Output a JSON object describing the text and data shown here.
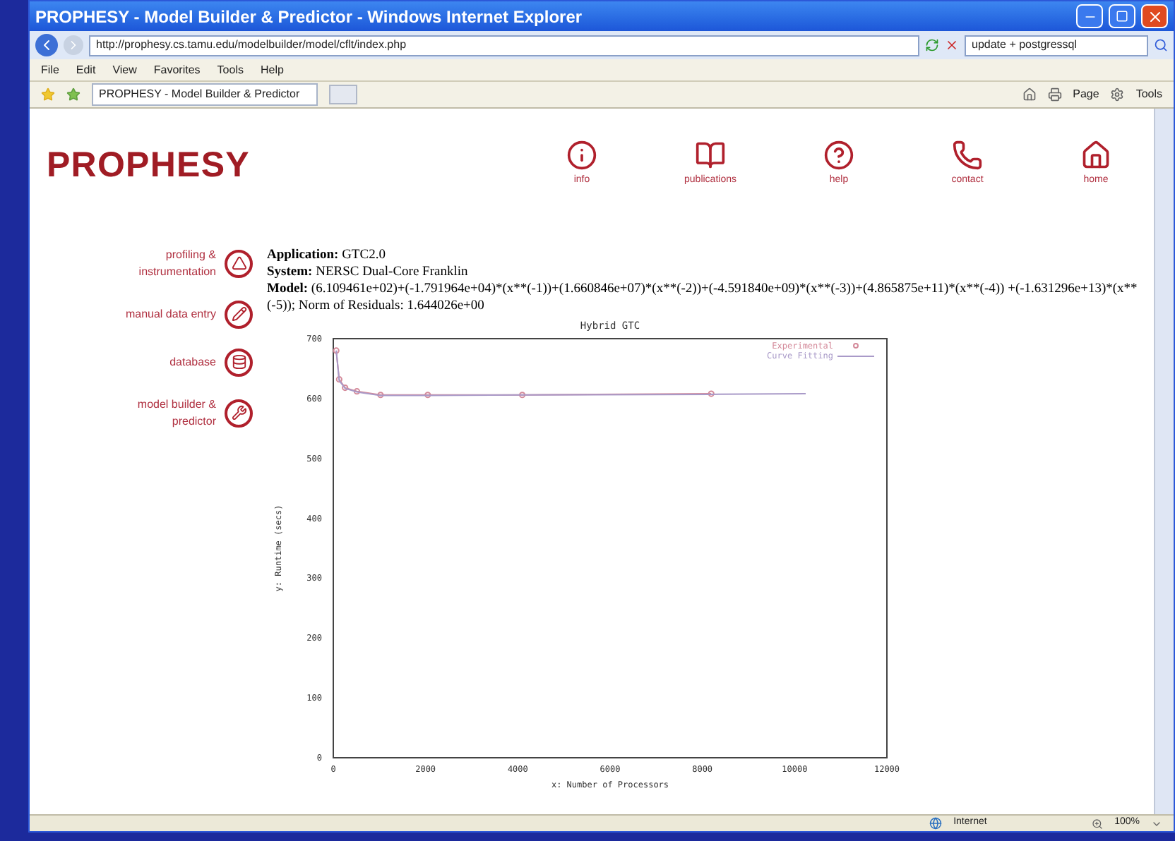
{
  "window": {
    "title": "PROPHESY - Model Builder & Predictor - Windows Internet Explorer"
  },
  "address_bar": {
    "url": "http://prophesy.cs.tamu.edu/modelbuilder/model/cflt/index.php",
    "search_value": "update + postgressql"
  },
  "menu": [
    "File",
    "Edit",
    "View",
    "Favorites",
    "Tools",
    "Help"
  ],
  "tab": {
    "title": "PROPHESY - Model Builder & Predictor"
  },
  "command_bar": [
    "Page",
    "Tools"
  ],
  "page": {
    "logo": "PROPHESY",
    "top_nav": [
      {
        "kind": "info",
        "label": "info"
      },
      {
        "kind": "publications",
        "label": "publications"
      },
      {
        "kind": "help",
        "label": "help"
      },
      {
        "kind": "contact",
        "label": "contact"
      },
      {
        "kind": "home",
        "label": "home"
      }
    ],
    "side_nav": [
      {
        "kind": "profiling",
        "label": "profiling & instrumentation"
      },
      {
        "kind": "entry",
        "label": "manual data entry"
      },
      {
        "kind": "database",
        "label": "database"
      },
      {
        "kind": "builder",
        "label": "model builder & predictor"
      }
    ],
    "info": [
      {
        "label": "Application:",
        "value": "GTC2.0"
      },
      {
        "label": "System:",
        "value": "NERSC Dual-Core Franklin"
      },
      {
        "label": "Model:",
        "value": "(6.109461e+02)+(-1.791964e+04)*(x**(-1))+(1.660846e+07)*(x**(-2))+(-4.591840e+09)*(x**(-3))+(4.865875e+11)*(x**(-4)) +(-1.631296e+13)*(x**(-5)); Norm of Residuals: 1.644026e+00"
      }
    ],
    "chart_data": {
      "type": "line",
      "title": "Hybrid GTC",
      "xlabel": "x: Number of Processors",
      "ylabel": "y: Runtime (secs)",
      "x": [
        64,
        128,
        256,
        512,
        1024,
        2048,
        4096,
        8192,
        10240
      ],
      "series": [
        {
          "name": "Experimental",
          "color": "#d48a9a",
          "marker": "circle",
          "values": [
            680,
            632,
            618,
            612,
            606,
            606,
            606,
            608,
            null
          ]
        },
        {
          "name": "Curve Fitting",
          "color": "#a99ac8",
          "values": [
            680,
            630,
            617,
            611,
            605,
            605,
            606,
            607,
            608
          ]
        }
      ],
      "xlim": [
        0,
        12000
      ],
      "ylim": [
        0,
        700
      ],
      "xticks": [
        0,
        2000,
        4000,
        6000,
        8000,
        10000,
        12000
      ],
      "yticks": [
        0,
        100,
        200,
        300,
        400,
        500,
        600,
        700
      ]
    }
  },
  "status_bar": {
    "zone": "Internet",
    "zoom": "100%"
  }
}
